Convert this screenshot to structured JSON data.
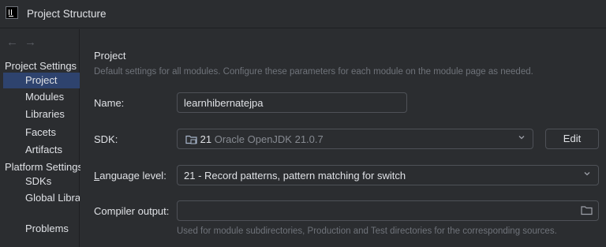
{
  "window": {
    "title": "Project Structure",
    "icon": "intellij-icon"
  },
  "nav": {
    "back": "←",
    "forward": "→"
  },
  "sidebar": {
    "project_settings_header": "Project Settings",
    "project_items": [
      {
        "label": "Project",
        "selected": true
      },
      {
        "label": "Modules",
        "selected": false
      },
      {
        "label": "Libraries",
        "selected": false
      },
      {
        "label": "Facets",
        "selected": false
      },
      {
        "label": "Artifacts",
        "selected": false
      }
    ],
    "platform_settings_header": "Platform Settings",
    "platform_items": [
      {
        "label": "SDKs"
      },
      {
        "label": "Global Libraries"
      }
    ],
    "problems": "Problems"
  },
  "main": {
    "heading": "Project",
    "description": "Default settings for all modules. Configure these parameters for each module on the module page as needed.",
    "name": {
      "label": "Name:",
      "value": "learnhibernatejpa"
    },
    "sdk": {
      "label": "SDK:",
      "version": "21",
      "detail": "Oracle OpenJDK 21.0.7",
      "edit_label": "Edit"
    },
    "language_level": {
      "label_mnemonic": "L",
      "label_rest": "anguage level:",
      "value": "21 - Record patterns, pattern matching for switch"
    },
    "compiler_output": {
      "label": "Compiler output:",
      "value": "",
      "hint": "Used for module subdirectories, Production and Test directories for the corresponding sources."
    }
  },
  "colors": {
    "selection": "#2e436e",
    "background": "#2b2d30",
    "text": "#dfe1e5",
    "muted": "#6f737a"
  }
}
